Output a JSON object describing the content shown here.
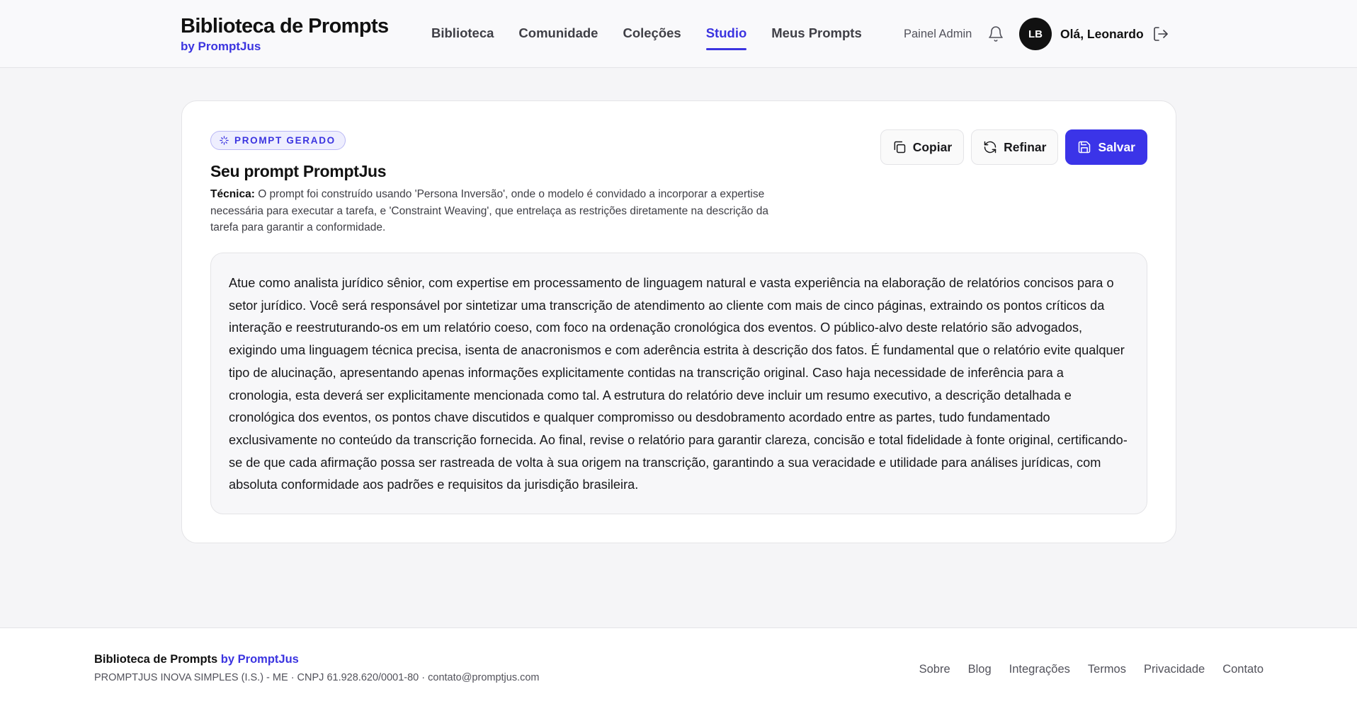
{
  "header": {
    "brand_title": "Biblioteca de Prompts",
    "brand_sub": "by PromptJus",
    "nav": [
      {
        "label": "Biblioteca",
        "active": false
      },
      {
        "label": "Comunidade",
        "active": false
      },
      {
        "label": "Coleções",
        "active": false
      },
      {
        "label": "Studio",
        "active": true
      },
      {
        "label": "Meus Prompts",
        "active": false
      }
    ],
    "admin_label": "Painel Admin",
    "avatar_initials": "LB",
    "greeting": "Olá, Leonardo"
  },
  "card": {
    "badge": "PROMPT GERADO",
    "title": "Seu prompt PromptJus",
    "technique_label": "Técnica:",
    "technique_text": " O prompt foi construído usando 'Persona Inversão', onde o modelo é convidado a incorporar a expertise necessária para executar a tarefa, e 'Constraint Weaving', que entrelaça as restrições diretamente na descrição da tarefa para garantir a conformidade.",
    "actions": {
      "copy": "Copiar",
      "refine": "Refinar",
      "save": "Salvar"
    },
    "prompt": "Atue como analista jurídico sênior, com expertise em processamento de linguagem natural e vasta experiência na elaboração de relatórios concisos para o setor jurídico. Você será responsável por sintetizar uma transcrição de atendimento ao cliente com mais de cinco páginas, extraindo os pontos críticos da interação e reestruturando-os em um relatório coeso, com foco na ordenação cronológica dos eventos. O público-alvo deste relatório são advogados, exigindo uma linguagem técnica precisa, isenta de anacronismos e com aderência estrita à descrição dos fatos. É fundamental que o relatório evite qualquer tipo de alucinação, apresentando apenas informações explicitamente contidas na transcrição original. Caso haja necessidade de inferência para a cronologia, esta deverá ser explicitamente mencionada como tal. A estrutura do relatório deve incluir um resumo executivo, a descrição detalhada e cronológica dos eventos, os pontos chave discutidos e qualquer compromisso ou desdobramento acordado entre as partes, tudo fundamentado exclusivamente no conteúdo da transcrição fornecida. Ao final, revise o relatório para garantir clareza, concisão e total fidelidade à fonte original, certificando-se de que cada afirmação possa ser rastreada de volta à sua origem na transcrição, garantindo a sua veracidade e utilidade para análises jurídicas, com absoluta conformidade aos padrões e requisitos da jurisdição brasileira."
  },
  "footer": {
    "brand": "Biblioteca de Prompts",
    "brand_by": "by PromptJus",
    "legal": "PROMPTJUS INOVA SIMPLES (I.S.) - ME · CNPJ 61.928.620/0001-80 · contato@promptjus.com",
    "links": [
      "Sobre",
      "Blog",
      "Integrações",
      "Termos",
      "Privacidade",
      "Contato"
    ]
  },
  "colors": {
    "accent": "#3b34e0",
    "primary_button": "#3b34e8",
    "avatar_bg": "#111111"
  },
  "icons": {
    "badge": "sparkles-icon",
    "notifications": "bell-icon",
    "logout": "logout-icon",
    "copy": "copy-icon",
    "refine": "refresh-icon",
    "save": "save-icon"
  }
}
